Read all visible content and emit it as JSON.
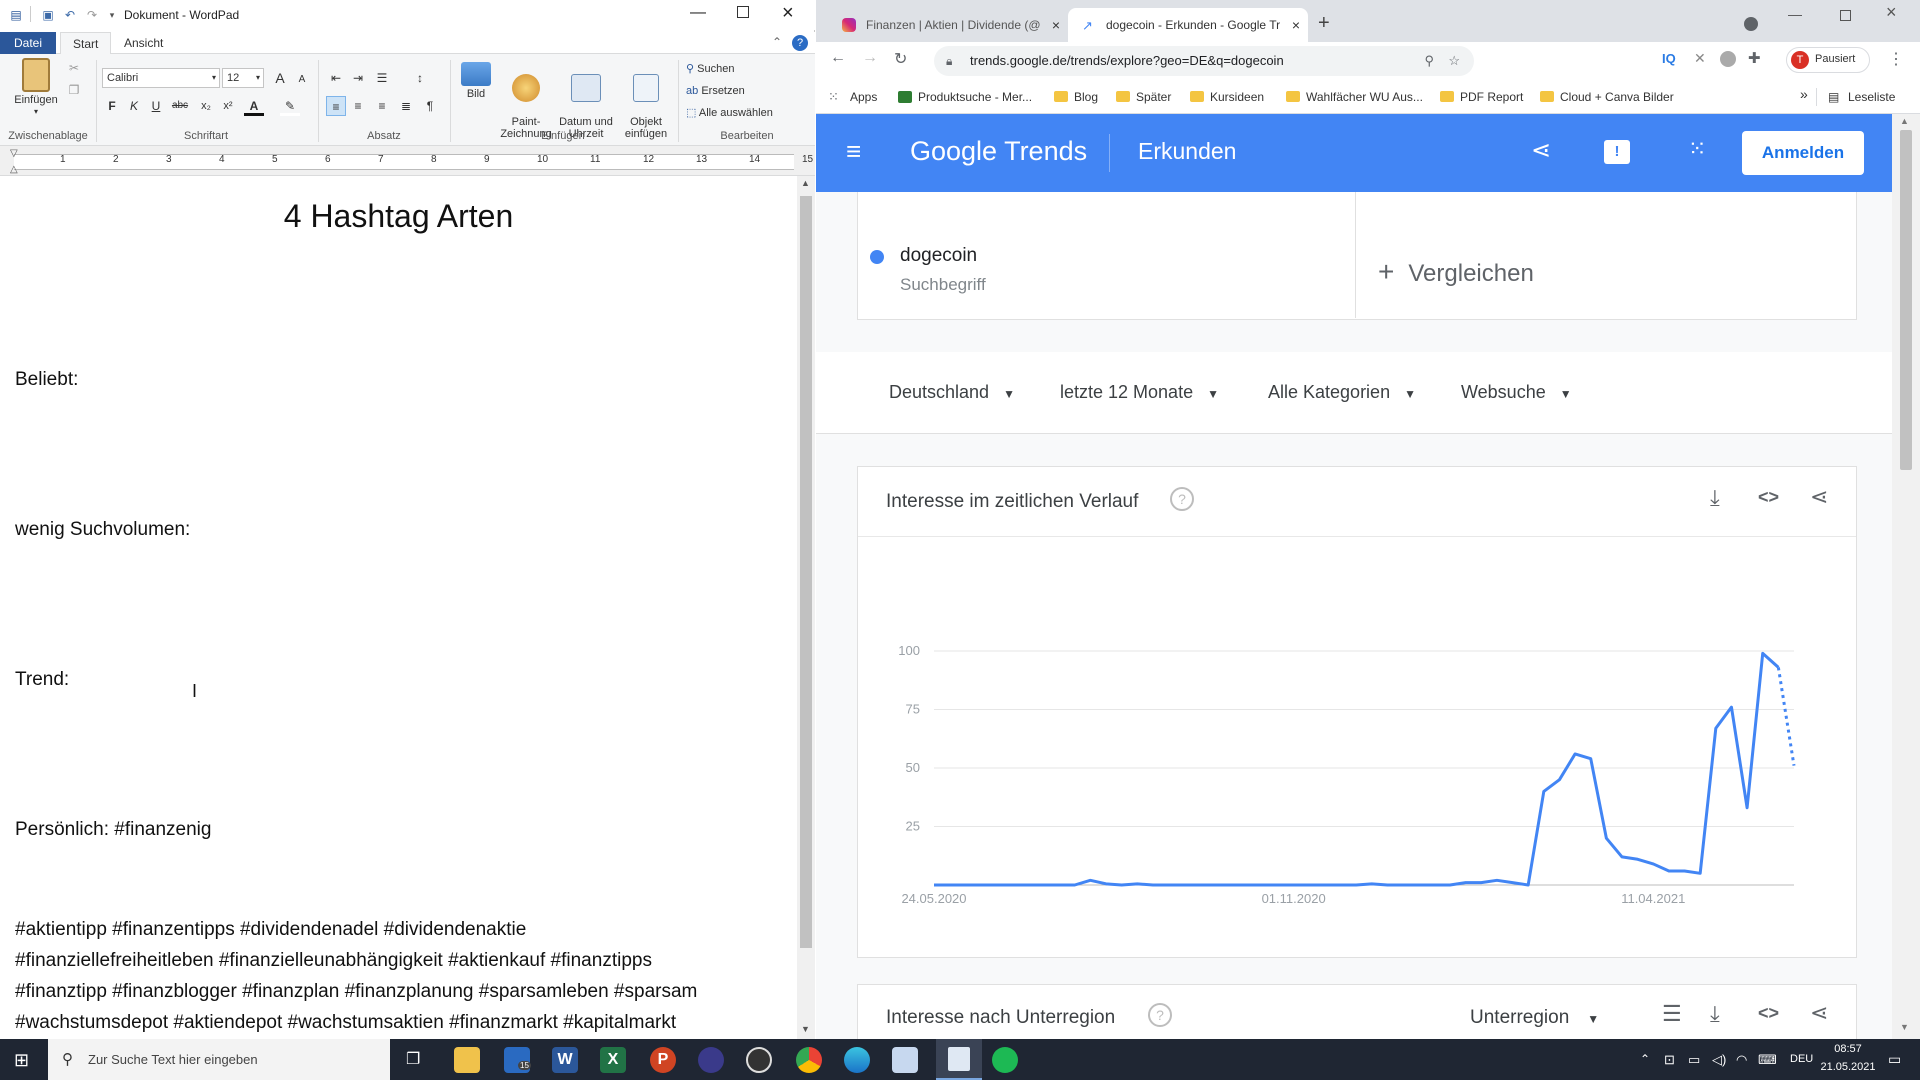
{
  "wordpad": {
    "title": "Dokument - WordPad",
    "tabs": [
      {
        "label": "Datei"
      },
      {
        "label": "Start"
      },
      {
        "label": "Ansicht"
      }
    ],
    "ribbon": {
      "paste_label": "Einfügen",
      "clipboard_group": "Zwischenablage",
      "font_name": "Calibri",
      "font_size": "12",
      "font_group": "Schriftart",
      "paragraph_group": "Absatz",
      "image_label": "Bild",
      "paint_label": "Paint-\nZeichnung",
      "datetime_label": "Datum und\nUhrzeit",
      "object_label": "Objekt\neinfügen",
      "insert_group": "Einfügen",
      "find_label": "Suchen",
      "replace_label": "Ersetzen",
      "select_all_label": "Alle auswählen",
      "edit_group": "Bearbeiten",
      "bold": "F",
      "italic": "K",
      "underline": "U",
      "strike": "abc",
      "grow_font": "A",
      "shrink_font": "A"
    },
    "document": {
      "heading": "4 Hashtag Arten",
      "beliebt": "Beliebt:",
      "wenig": "wenig Suchvolumen:",
      "trend": "Trend:",
      "persoenlich": "Persönlich: #finanzenig",
      "hashtags": [
        "#aktientipp #finanzentipps #dividendenadel #dividendenaktie",
        "#finanziellefreiheitleben #finanzielleunabhängigkeit #aktienkauf #finanztipps",
        "#finanztipp #finanzblogger #finanzplan #finanzplanung #sparsamleben #sparsam",
        "#wachstumsdepot #aktiendepot #wachstumsaktien #finanzmarkt #kapitalmarkt"
      ]
    },
    "ruler_numbers": [
      "1",
      "2",
      "3",
      "4",
      "5",
      "6",
      "7",
      "8",
      "9",
      "10",
      "11",
      "12",
      "13",
      "14",
      "15"
    ]
  },
  "chrome": {
    "tabs": [
      {
        "label": "Finanzen | Aktien | Dividende (@"
      },
      {
        "label": "dogecoin - Erkunden - Google Tr"
      }
    ],
    "new_tab": "+",
    "url": "trends.google.de/trends/explore?geo=DE&q=dogecoin",
    "profile_label": "Pausiert",
    "profile_initial": "T",
    "iq_label": "IQ",
    "bookmarks": [
      {
        "label": "Apps"
      },
      {
        "label": "Produktsuche - Mer..."
      },
      {
        "label": "Blog"
      },
      {
        "label": "Später"
      },
      {
        "label": "Kursideen"
      },
      {
        "label": "Wahlfächer WU Aus..."
      },
      {
        "label": "PDF Report"
      },
      {
        "label": "Cloud + Canva Bilder"
      }
    ],
    "reading_list": "Leseliste",
    "more_bookmarks": "»"
  },
  "trends": {
    "logo": "Google Trends",
    "section": "Erkunden",
    "signin": "Anmelden",
    "term": "dogecoin",
    "term_type": "Suchbegriff",
    "compare": "Vergleichen",
    "filters": [
      "Deutschland",
      "letzte 12 Monate",
      "Alle Kategorien",
      "Websuche"
    ],
    "chart_title": "Interesse im zeitlichen Verlauf",
    "subregion_title": "Interesse nach Unterregion",
    "subregion_select": "Unterregion",
    "series_color": "#4285f4"
  },
  "chart_data": {
    "type": "line",
    "title": "Interesse im zeitlichen Verlauf",
    "xlabel": "",
    "ylabel": "",
    "ylim": [
      0,
      100
    ],
    "y_ticks": [
      "100",
      "75",
      "50",
      "25"
    ],
    "x_tick_labels": [
      "24.05.2020",
      "01.11.2020",
      "11.04.2021"
    ],
    "x_tick_index": [
      0,
      23,
      46
    ],
    "series": [
      {
        "values": [
          0,
          0,
          0,
          0,
          0,
          0,
          0,
          0,
          0,
          0,
          2,
          0.5,
          0,
          0.5,
          0,
          0,
          0,
          0,
          0,
          0,
          0,
          0,
          0,
          0,
          0,
          0,
          0,
          0,
          0.5,
          0,
          0,
          0,
          0,
          0,
          1,
          1,
          2,
          1,
          0,
          40,
          45,
          56,
          54,
          20,
          12,
          11,
          9,
          6,
          6,
          5,
          67,
          76,
          33,
          99,
          93,
          51
        ],
        "projected_from": 54
      }
    ]
  },
  "taskbar": {
    "search_placeholder": "Zur Suche Text hier eingeben",
    "lang": "DEU",
    "time": "08:57",
    "date": "21.05.2021",
    "mail_badge": "15"
  }
}
